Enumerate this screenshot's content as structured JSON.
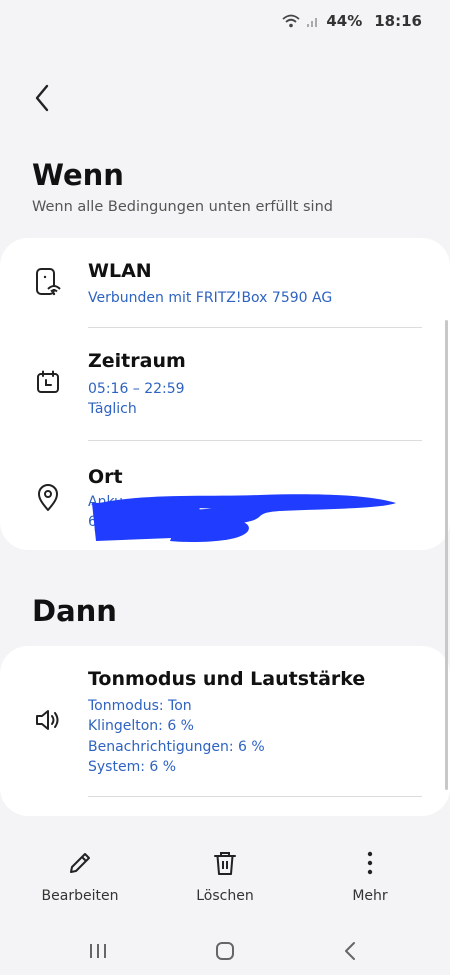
{
  "status_bar": {
    "battery": "44%",
    "time": "18:16"
  },
  "when": {
    "title": "Wenn",
    "subtitle": "Wenn alle Bedingungen unten erfüllt sind",
    "conditions": [
      {
        "title": "WLAN",
        "lines": [
          "Verbunden mit FRITZ!Box 7590 AG"
        ],
        "icon": "wifi-phone-icon"
      },
      {
        "title": "Zeitraum",
        "lines": [
          "05:16 – 22:59",
          "Täglich"
        ],
        "icon": "calendar-clock-icon"
      },
      {
        "title": "Ort",
        "lines": [
          "Anku",
          "6"
        ],
        "icon": "location-pin-icon"
      }
    ]
  },
  "then": {
    "title": "Dann",
    "actions": [
      {
        "title": "Tonmodus und Lautstärke",
        "lines": [
          "Tonmodus: Ton",
          "Klingelton: 6 %",
          "Benachrichtigungen: 6 %",
          "System: 6 %"
        ],
        "icon": "speaker-icon"
      }
    ]
  },
  "bottom_actions": {
    "edit": "Bearbeiten",
    "delete": "Löschen",
    "more": "Mehr"
  },
  "colors": {
    "accent": "#2e63c1",
    "redaction": "#1f3cff",
    "background": "#f4f4f6"
  }
}
